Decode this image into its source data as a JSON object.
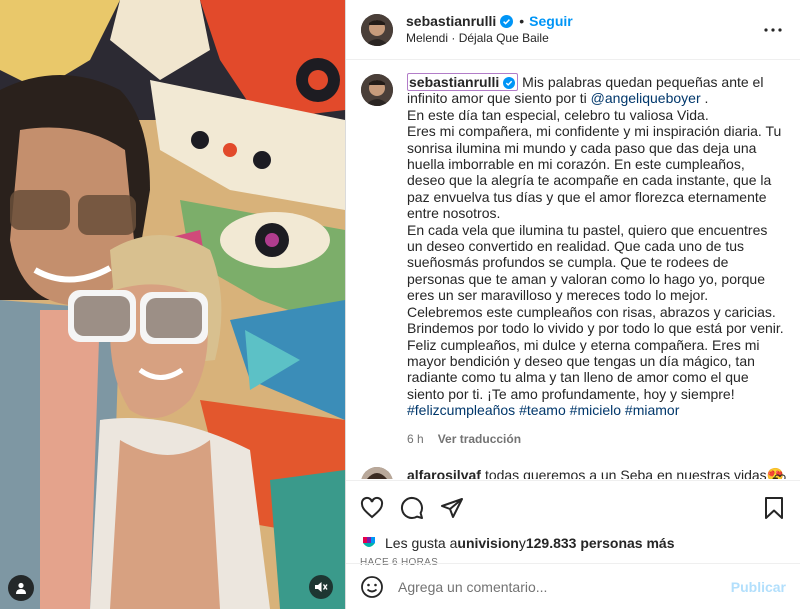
{
  "post": {
    "username": "sebastianrulli",
    "follow_label": "Seguir",
    "separator": "•",
    "music_artist": "Melendi",
    "music_separator": "·",
    "music_title": "Déjala Que Baile"
  },
  "caption": {
    "username": "sebastianrulli",
    "text_1": " Mis palabras quedan pequeñas ante el infinito amor que siento por ti ",
    "mention": "@angeliqueboyer",
    "text_2": " .",
    "paragraphs": [
      "En este día tan especial, celebro tu valiosa Vida.",
      "Eres mi compañera, mi confidente y mi inspiración diaria. Tu sonrisa ilumina mi mundo y cada paso que das deja una huella imborrable en mi corazón. En este cumpleaños, deseo que la alegría te acompañe en cada instante, que la paz envuelva tus días y que el amor florezca eternamente entre nosotros.",
      "En cada vela que ilumina tu pastel, quiero que encuentres un deseo convertido en realidad. Que cada uno de tus sueñosmás profundos se cumpla. Que te rodees de personas que te aman y valoran como lo hago yo, porque eres un ser maravilloso y mereces todo lo mejor.",
      "Celebremos este cumpleaños con risas, abrazos y caricias. Brindemos por todo lo vivido y por todo lo que está por venir.",
      "Feliz cumpleaños, mi dulce y eterna compañera. Eres mi mayor bendición y deseo que tengas un día mágico, tan radiante como tu alma y tan lleno de amor como el que siento por ti. ¡Te amo profundamente, hoy y siempre!"
    ],
    "hashtags": [
      "#felizcumpleaños",
      "#teamo",
      "#micielo",
      "#miamor"
    ],
    "time": "6 h",
    "translate_label": "Ver traducción"
  },
  "comments": [
    {
      "username": "alfarosilvaf",
      "text": "todas queremos a un Seba en nuestras vidas😍"
    }
  ],
  "likes": {
    "prefix": "Les gusta a ",
    "first_user": "univision",
    "middle": " y ",
    "count": "129.833 personas más"
  },
  "timestamp": "HACE 6 HORAS",
  "composer": {
    "placeholder": "Agrega un comentario...",
    "publish_label": "Publicar"
  },
  "colors": {
    "accent": "#0095f6",
    "mention": "#00376b",
    "muted": "#737373",
    "verified": "#0095f6"
  }
}
